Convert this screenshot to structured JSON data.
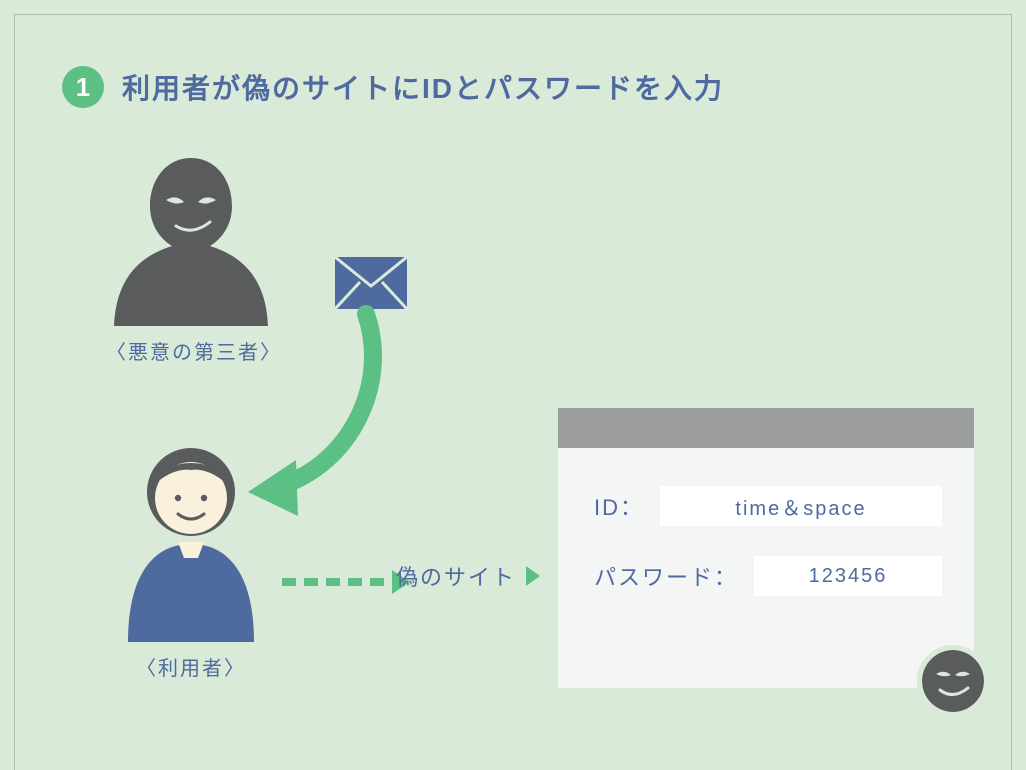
{
  "step": {
    "number": "1",
    "title": "利用者が偽のサイトにIDとパスワードを入力"
  },
  "actors": {
    "attacker_label": "〈悪意の第三者〉",
    "user_label": "〈利用者〉"
  },
  "arrow": {
    "fake_site_label": "偽のサイト"
  },
  "login_form": {
    "id_label": "ID：",
    "id_value": "time＆space",
    "password_label": "パスワード：",
    "password_value": "123456"
  },
  "icons": {
    "envelope": "envelope-icon",
    "attacker": "attacker-silhouette-icon",
    "user": "user-person-icon",
    "spy": "spy-face-icon"
  },
  "colors": {
    "bg": "#d9ead9",
    "accent_green": "#5cbf84",
    "accent_blue": "#4e6a9e",
    "dark_gray": "#5a5b5c",
    "mid_gray": "#9d9e9f",
    "panel": "#f4f5f5",
    "skin": "#faf1dc"
  }
}
